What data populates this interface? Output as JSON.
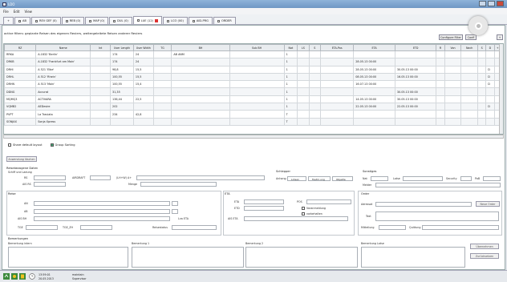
{
  "window": {
    "title": "LDO"
  },
  "menu": [
    "File",
    "Edit",
    "View"
  ],
  "tabs": [
    {
      "label": "+",
      "active": false
    },
    {
      "label": "AB",
      "active": false
    },
    {
      "label": "REV GEF (0)",
      "active": false
    },
    {
      "label": "REB (0)",
      "active": false
    },
    {
      "label": "MAP (0)",
      "active": false
    },
    {
      "label": "DUL (0)",
      "active": false
    },
    {
      "label": "LUE (12)",
      "active": true
    },
    {
      "label": "LCO (00)",
      "active": false
    },
    {
      "label": "AID-PRG",
      "active": false
    },
    {
      "label": "ORDER",
      "active": false
    }
  ],
  "info_text": "active filters: geplante Reisen des eigenen Reviers, weitergeleitete Reisen anderer Reviers",
  "configure_filter_label": "Configure Filter",
  "configure_label": "Confi",
  "grid": {
    "columns": [
      "RZ",
      "Name",
      "Int",
      "User Length",
      "User Width",
      "TG",
      "BH",
      "Sub BH",
      "Nat",
      "LS",
      "S",
      "ETA-Pos",
      "ETA",
      "ETD",
      "R",
      "Von",
      "Nach",
      "S",
      "D",
      "+"
    ],
    "rows": [
      [
        "RRKA",
        "A.1832 'Berlin'",
        "",
        "174",
        "24",
        "",
        "AB ANM",
        "",
        "1",
        "",
        "",
        "",
        "",
        "",
        "",
        "",
        "",
        "",
        "",
        ""
      ],
      [
        "DRKB",
        "A.1832 'Frankfurt am Main'",
        "",
        "174",
        "24",
        "",
        "",
        "",
        "1",
        "",
        "",
        "",
        "28.05.13 00:00",
        "",
        "",
        "",
        "",
        "",
        "",
        ""
      ],
      [
        "DRHI",
        "A 521 'Elbe'",
        "",
        "98,8",
        "15,5",
        "",
        "",
        "",
        "1",
        "",
        "",
        "",
        "28.05.13 00:00",
        "30.05.13 00:00",
        "",
        "",
        "",
        "",
        "D",
        ""
      ],
      [
        "DRHL",
        "A 512 'Rhein'",
        "",
        "100,55",
        "15,5",
        "",
        "",
        "",
        "1",
        "",
        "",
        "",
        "08.05.13 00:00",
        "16.05.13 00:00",
        "",
        "",
        "",
        "",
        "D",
        ""
      ],
      [
        "DRHN",
        "A 513 'Main'",
        "",
        "100,55",
        "15,4",
        "",
        "",
        "",
        "1",
        "",
        "",
        "",
        "16.07.13 00:00",
        "",
        "",
        "",
        "",
        "",
        "D",
        ""
      ],
      [
        "DDNG",
        "Accurat",
        "",
        "31,35",
        "",
        "",
        "",
        "",
        "1",
        "",
        "",
        "",
        "",
        "30.05.13 00:00",
        "",
        "",
        "",
        "",
        "",
        ""
      ],
      [
        "MQMQ3",
        "ACTIVARA",
        "",
        "136,44",
        "22,5",
        "",
        "",
        "",
        "1",
        "",
        "",
        "",
        "14.05.13 00:00",
        "30.05.13 00:00",
        "",
        "",
        "",
        "",
        "",
        ""
      ],
      [
        "VQMB2",
        "AEDesire",
        "",
        "202",
        "",
        "",
        "",
        "",
        "1",
        "",
        "",
        "",
        "22.05.13 00:00",
        "22.05.13 00:00",
        "",
        "",
        "",
        "",
        "D",
        ""
      ],
      [
        "PVPT",
        "La Traviata",
        "",
        "234",
        "42,8",
        "",
        "",
        "",
        "T",
        "",
        "",
        "",
        "",
        "",
        "",
        "",
        "",
        "",
        "",
        ""
      ],
      [
        "SONJAX",
        "Sonja Xpress",
        "",
        "",
        "",
        "",
        "",
        "",
        "T",
        "",
        "",
        "",
        "",
        "",
        "",
        "",
        "",
        "",
        "",
        ""
      ]
    ]
  },
  "options": {
    "share_layout": {
      "label": "Share default layout",
      "checked": false
    },
    "group_sorting": {
      "label": "Group Sorting",
      "checked": true
    }
  },
  "anwendung_label": "Anwendung löschen",
  "reise": {
    "reisebezogene_title": "Reisebezogene Daten",
    "schiff_label": "Schiff und Ladung",
    "rs_label": "RS",
    "airdraft_label": "AIRDRAFT",
    "lhyw_label": "(LH+W) A+",
    "ais_label": "AIS RS",
    "menge_label": "Menge"
  },
  "schlepper": {
    "title": "Schlepper",
    "anhang_label": "Anhang",
    "boxes": [
      "Lotsen",
      "Festm.ung",
      "Objekte"
    ]
  },
  "sonstiges": {
    "title": "Sonstiges",
    "nat_label": "Nat",
    "lotse_label": "Lotse",
    "security_label": "Security",
    "pob_label": "PoB",
    "melder_label": "Melder"
  },
  "route": {
    "title": "Reise",
    "an_label": "AN",
    "ab_label": "AB",
    "ais_bh_label": "AIS BH",
    "tge_label": "TGE",
    "tge_zh_label": "TGE_ZH",
    "reisestatus_label": "Reisestatus",
    "lva_label": "Lva ETA"
  },
  "eta": {
    "title": "ETA",
    "eta_label": "ETA",
    "etd_label": "ETD",
    "pos_label": "POS",
    "ais_eta_label": "AIS ETA",
    "anmeldung_label": "Voranmeldung",
    "gehalten_label": "vorbehalten"
  },
  "order": {
    "title": "Order",
    "adressat_label": "Adressat",
    "neue_order": "Neue Order",
    "text_label": "Text",
    "mitteilung_label": "Mitteilung",
    "quittung_label": "Quittung"
  },
  "bemerkungen": {
    "title": "Bemerkungen",
    "intern": "Bemerkung intern",
    "b1": "Bemerkung 1",
    "b2": "Bemerkung 2",
    "lotse": "Bemerkung Lotse",
    "ubernehmen": "Übernehmen",
    "zurucksetzen": "Zurücksetzen"
  },
  "status": {
    "time": "13:59:01",
    "date": "20.05.2013",
    "user": "maintain",
    "role": "Supervisor"
  },
  "colors": {
    "titlebar": "#7aa0cc",
    "active_tab_close": "#dd3333",
    "status_green": "#3c8a3c"
  }
}
